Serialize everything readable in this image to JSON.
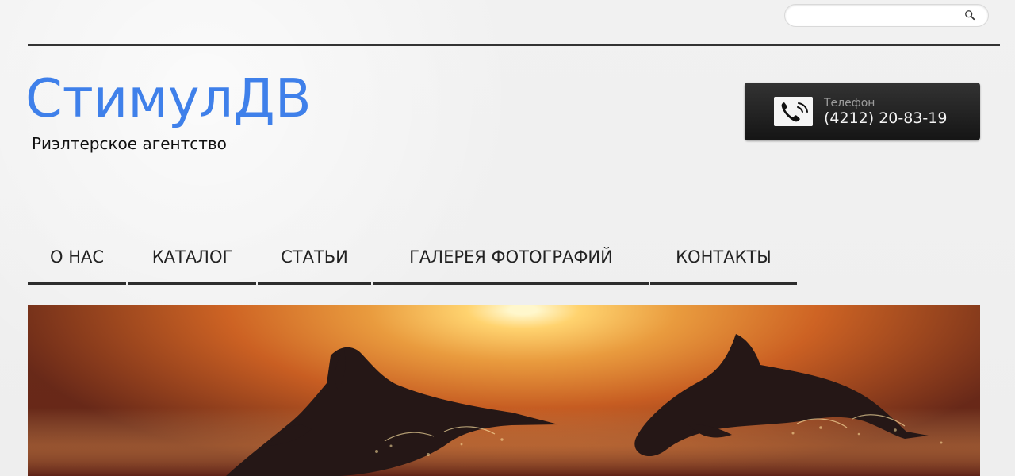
{
  "search": {
    "value": "",
    "placeholder": "",
    "icon": "search-icon"
  },
  "brand": {
    "title": "СтимулДВ",
    "subtitle": "Риэлтерское агентство",
    "accent_color": "#3f80ea"
  },
  "contact": {
    "label": "Телефон",
    "phone": "(4212) 20-83-19",
    "icon": "phone-icon"
  },
  "nav": {
    "items": [
      {
        "label": "О НАС"
      },
      {
        "label": "КАТАЛОГ"
      },
      {
        "label": "СТАТЬИ"
      },
      {
        "label": "ГАЛЕРЕЯ ФОТОГРАФИЙ"
      },
      {
        "label": "КОНТАКТЫ"
      }
    ]
  },
  "hero": {
    "image": "dolphins-sunset-image",
    "colors": [
      "#ffd36f",
      "#e99b3e",
      "#762e1c"
    ]
  }
}
